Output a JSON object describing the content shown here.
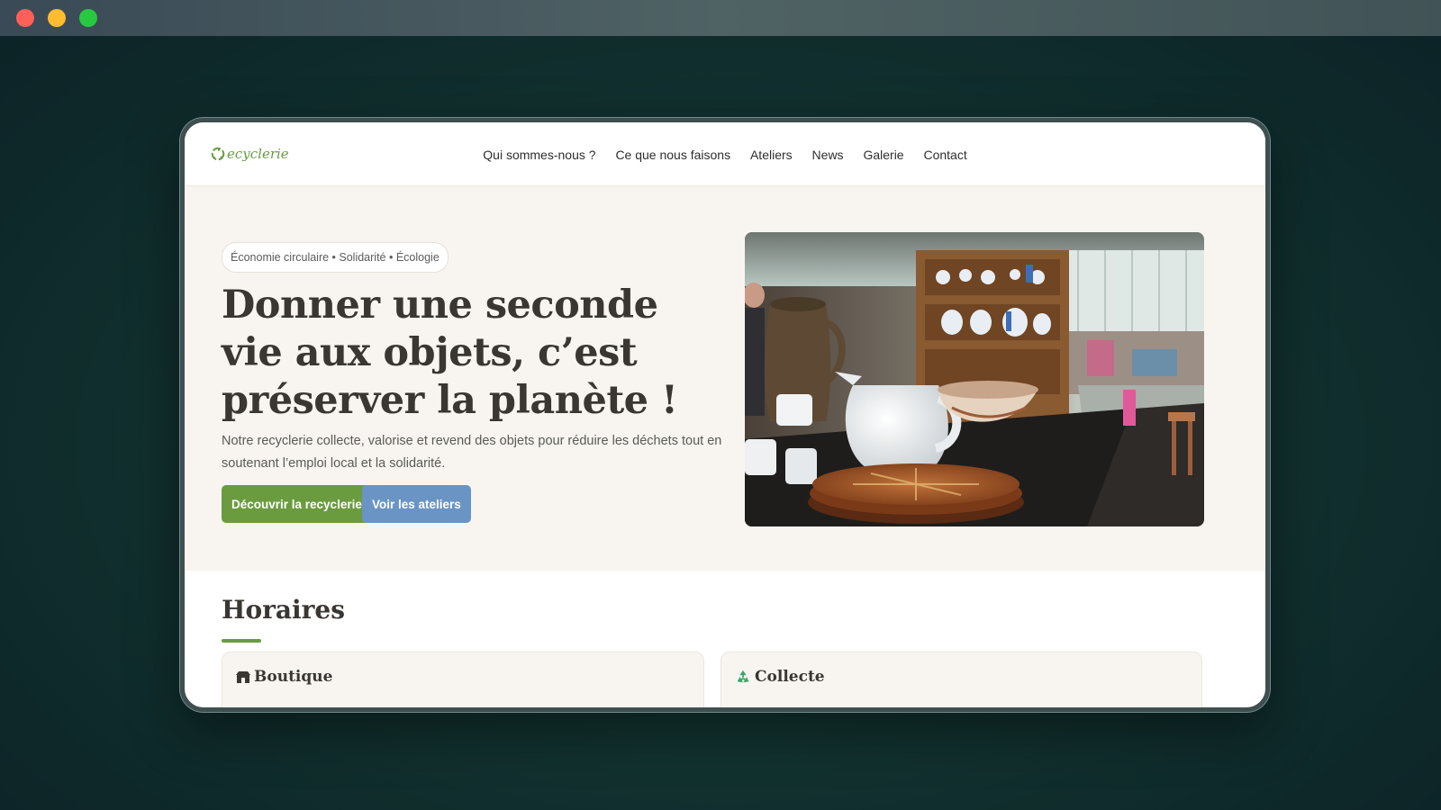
{
  "site": {
    "logo_text": "ecyclerie",
    "nav": [
      {
        "label": "Qui sommes-nous ?"
      },
      {
        "label": "Ce que nous faisons"
      },
      {
        "label": "Ateliers"
      },
      {
        "label": "News"
      },
      {
        "label": "Galerie"
      },
      {
        "label": "Contact"
      }
    ]
  },
  "hero": {
    "tagline": "Économie circulaire • Solidarité • Écologie",
    "title": "Donner une seconde vie aux objets, c’est préserver la planète !",
    "description": "Notre recyclerie collecte, valorise et revend des objets pour réduire les déchets tout en soutenant l’emploi local et la solidarité.",
    "primary_button": "Découvrir la recyclerie",
    "secondary_button": "Voir les ateliers"
  },
  "hours": {
    "title": "Horaires",
    "cards": [
      {
        "icon": "shop-icon",
        "title": "Boutique"
      },
      {
        "icon": "recycle-icon",
        "title": "Collecte"
      }
    ]
  },
  "colors": {
    "brand_green": "#6b9b3f",
    "accent_blue": "#6a94c4",
    "hero_background": "#f8f5f0"
  }
}
